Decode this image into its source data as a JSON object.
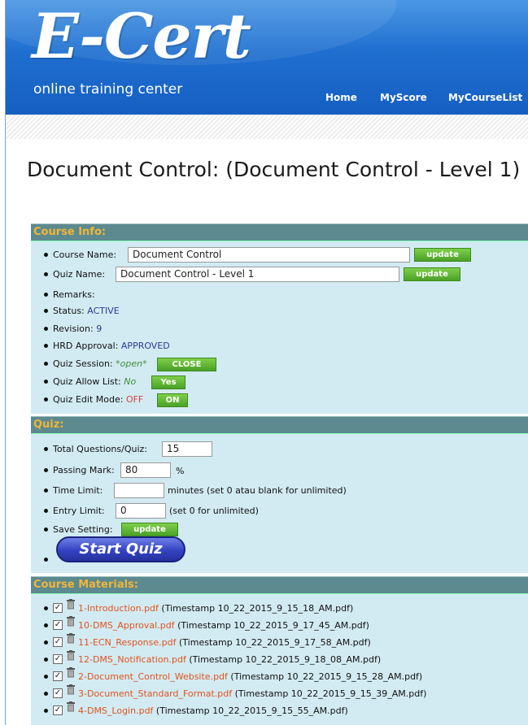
{
  "header": {
    "brand": "E-Cert",
    "tagline": "online training center",
    "nav": [
      "Home",
      "MyScore",
      "MyCourseList"
    ]
  },
  "page_title": "Document Control:  (Document Control - Level 1)",
  "course_info": {
    "heading": "Course Info:",
    "course_name_label": "Course Name:",
    "course_name_value": "Document Control",
    "quiz_name_label": "Quiz Name:",
    "quiz_name_value": "Document Control - Level 1",
    "update_label": "update",
    "remarks_label": "Remarks:",
    "status_label": "Status:",
    "status_value": "ACTIVE",
    "revision_label": "Revision:",
    "revision_value": "9",
    "hrd_label": "HRD Approval:",
    "hrd_value": "APPROVED",
    "session_label": "Quiz Session:",
    "session_value": "*open*",
    "session_button": "CLOSE",
    "allow_label": "Quiz Allow List:",
    "allow_value": "No",
    "allow_button": "Yes",
    "edit_label": "Quiz Edit Mode:",
    "edit_value": "OFF",
    "edit_button": "ON"
  },
  "quiz": {
    "heading": "Quiz:",
    "total_label": "Total Questions/Quiz:",
    "total_value": "15",
    "passing_label": "Passing Mark:",
    "passing_value": "80",
    "passing_unit": "%",
    "time_label": "Time Limit:",
    "time_value": "",
    "time_note": "minutes (set 0 atau blank for unlimited)",
    "entry_label": "Entry Limit:",
    "entry_value": "0",
    "entry_note": "(set 0 for unlimited)",
    "save_label": "Save Setting:",
    "save_button": "update",
    "start_button": "Start Quiz"
  },
  "materials": {
    "heading": "Course Materials:",
    "items": [
      {
        "file": "1-Introduction.pdf",
        "ts": "(Timestamp 10_22_2015_9_15_18_AM.pdf)"
      },
      {
        "file": "10-DMS_Approval.pdf",
        "ts": "(Timestamp 10_22_2015_9_17_45_AM.pdf)"
      },
      {
        "file": "11-ECN_Response.pdf",
        "ts": "(Timestamp 10_22_2015_9_17_58_AM.pdf)"
      },
      {
        "file": "12-DMS_Notification.pdf",
        "ts": "(Timestamp 10_22_2015_9_18_08_AM.pdf)"
      },
      {
        "file": "2-Document_Control_Website.pdf",
        "ts": "(Timestamp 10_22_2015_9_15_28_AM.pdf)"
      },
      {
        "file": "3-Document_Standard_Format.pdf",
        "ts": "(Timestamp 10_22_2015_9_15_39_AM.pdf)"
      },
      {
        "file": "4-DMS_Login.pdf",
        "ts": "(Timestamp 10_22_2015_9_15_55_AM.pdf)"
      }
    ]
  },
  "colors": {
    "header_blue": "#1f6fd0",
    "panel_head": "#5c8a8e",
    "panel_head_text": "#f0b63a",
    "panel_body": "#d2ebf2",
    "button_green": "#4aa127",
    "link_orange": "#e0531e"
  }
}
